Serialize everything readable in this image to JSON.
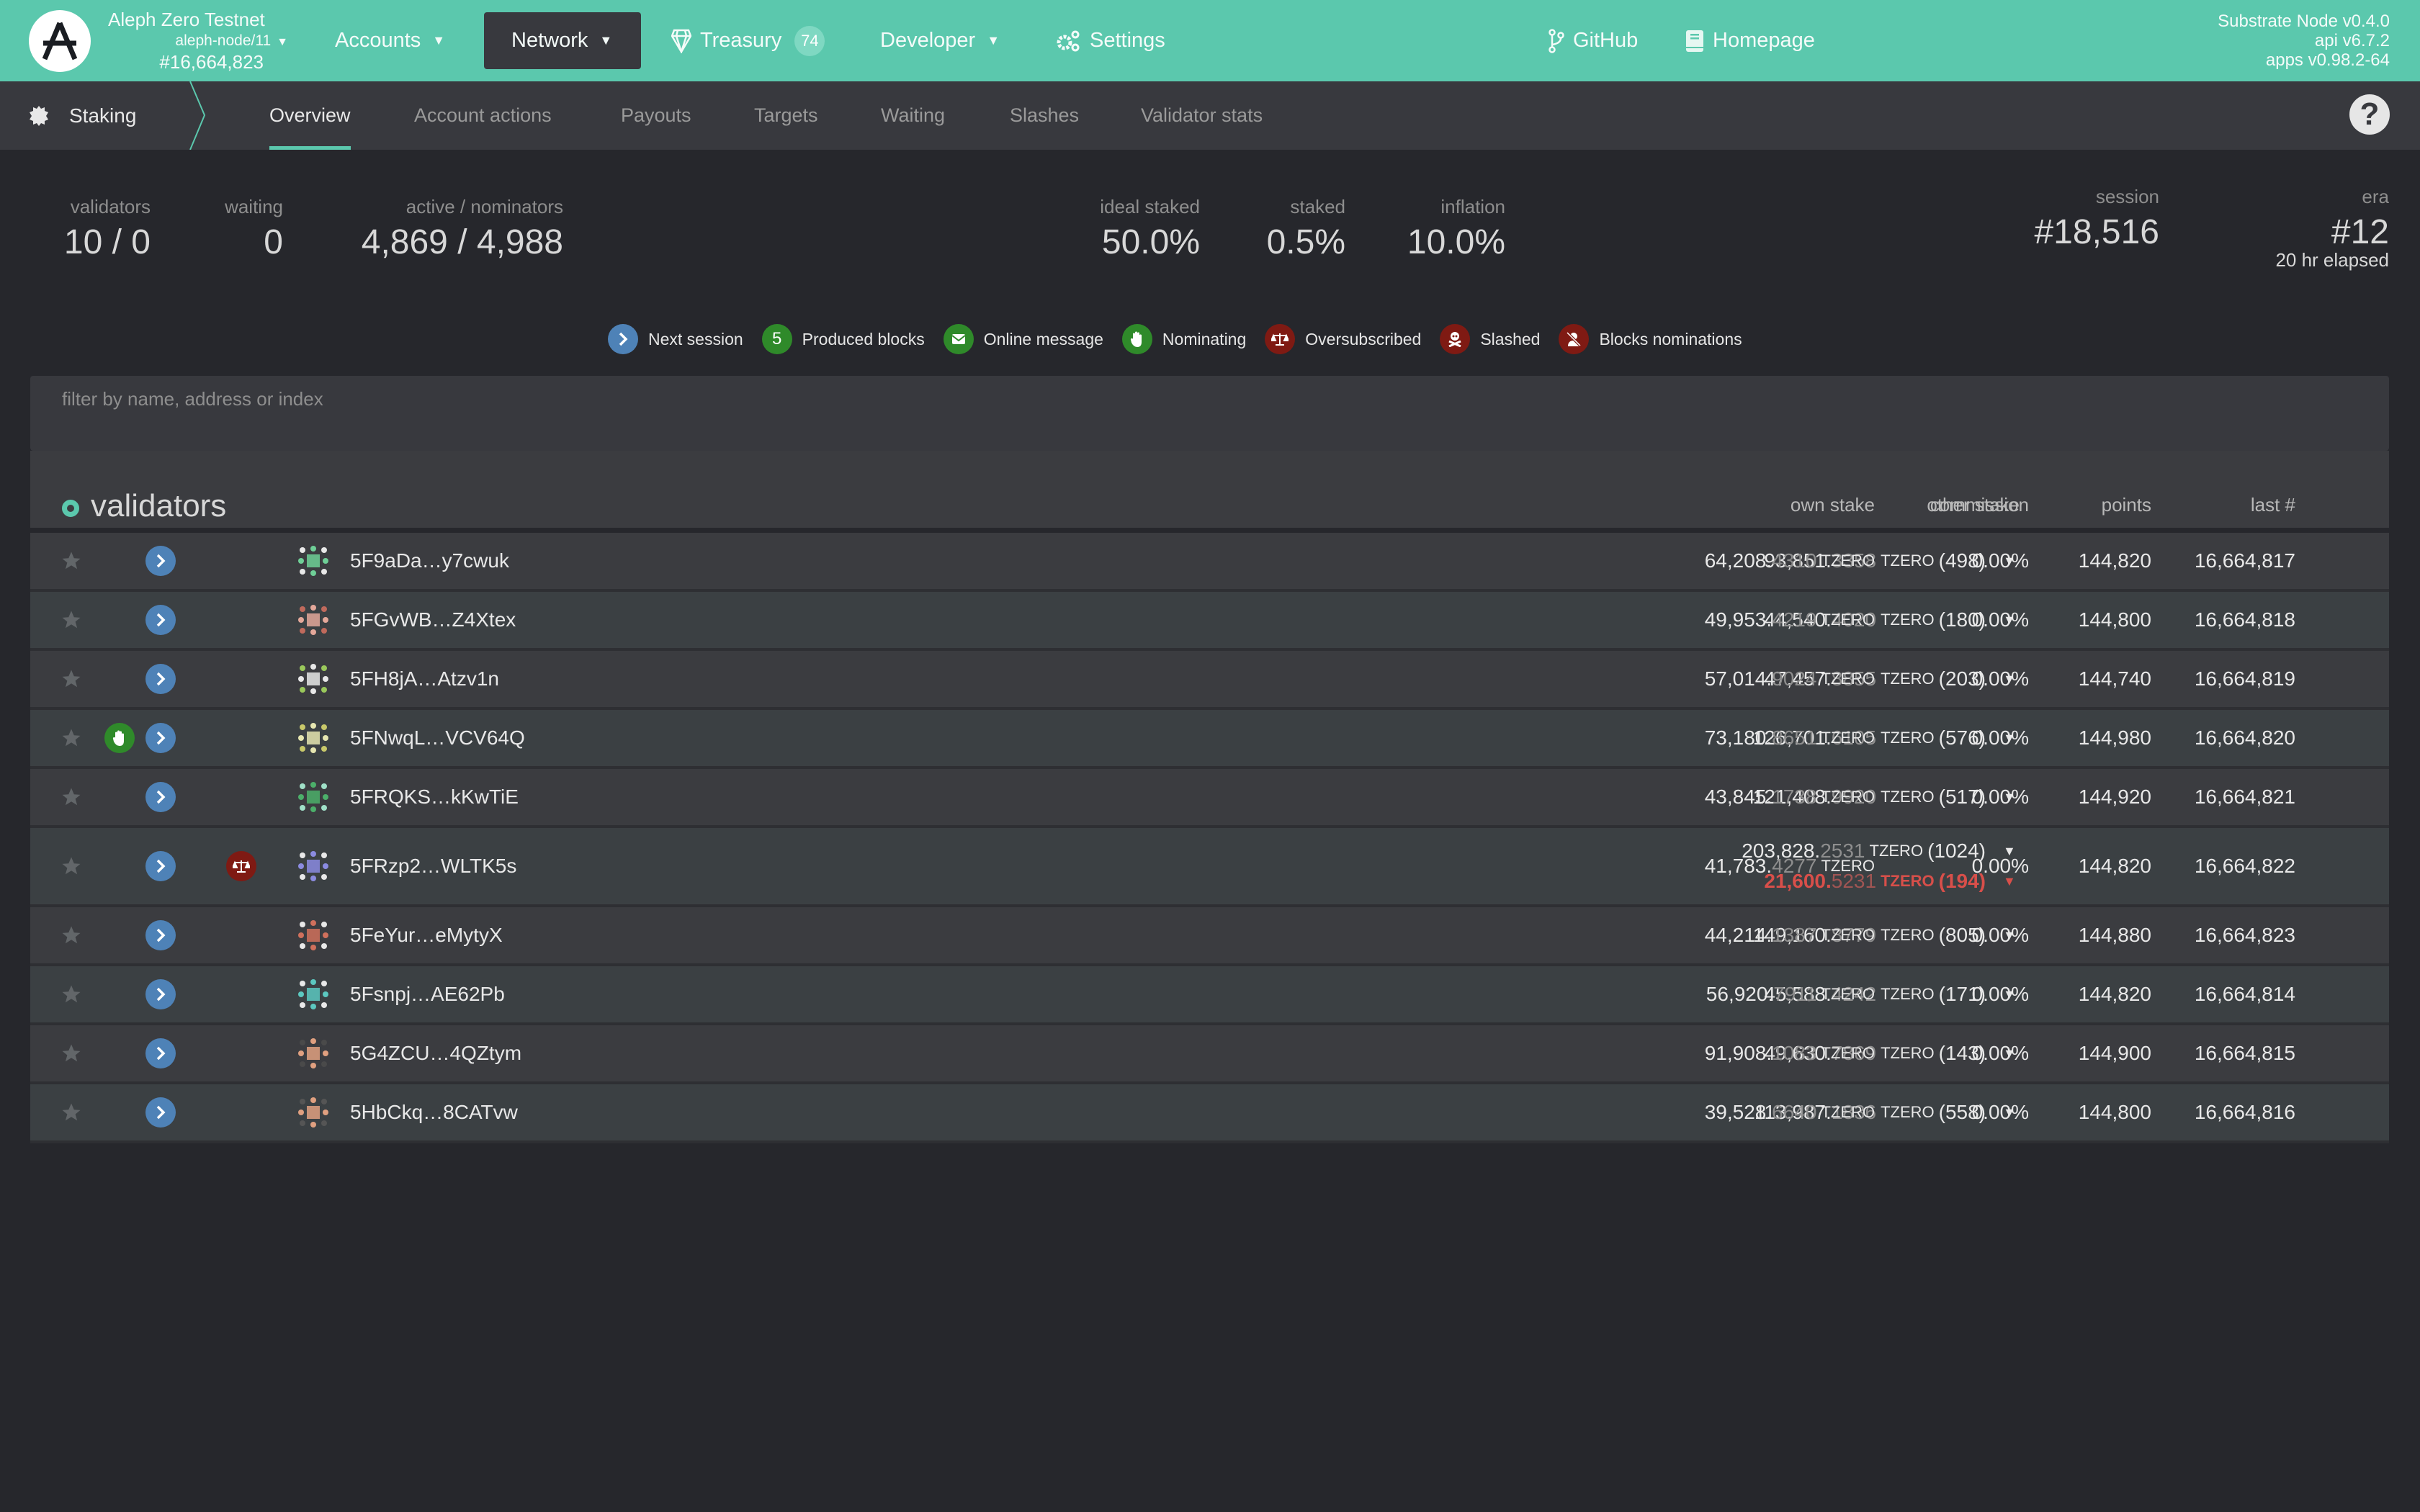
{
  "header": {
    "chain_name": "Aleph Zero Testnet",
    "node_name": "aleph-node/11",
    "best_block": "#16,664,823",
    "nav": [
      {
        "label": "Accounts",
        "dropdown": true
      },
      {
        "label": "Network",
        "dropdown": true,
        "active": true
      },
      {
        "label": "Treasury",
        "badge": "74",
        "icon": "gem-icon"
      },
      {
        "label": "Developer",
        "dropdown": true
      },
      {
        "label": "Settings",
        "icon": "gears-icon"
      }
    ],
    "links": [
      {
        "label": "GitHub",
        "icon": "code-branch-icon"
      },
      {
        "label": "Homepage",
        "icon": "book-icon"
      }
    ],
    "versions": [
      "Substrate Node v0.4.0",
      "api v6.7.2",
      "apps v0.98.2-64"
    ],
    "accent_color": "#5bc8ad"
  },
  "subnav": {
    "section": "Staking",
    "tabs": [
      "Overview",
      "Account actions",
      "Payouts",
      "Targets",
      "Waiting",
      "Slashes",
      "Validator stats"
    ],
    "active_tab": "Overview",
    "help": "?"
  },
  "summary": {
    "validators": {
      "label": "validators",
      "value": "10 / 0"
    },
    "waiting": {
      "label": "waiting",
      "value": "0"
    },
    "nominators": {
      "label": "active / nominators",
      "value": "4,869 / 4,988"
    },
    "ideal_staked": {
      "label": "ideal staked",
      "value": "50.0%"
    },
    "staked": {
      "label": "staked",
      "value": "0.5%"
    },
    "inflation": {
      "label": "inflation",
      "value": "10.0%"
    },
    "session": {
      "label": "session",
      "value": "#18,516"
    },
    "era": {
      "label": "era",
      "value": "#12",
      "sub": "20 hr elapsed"
    }
  },
  "legend": [
    {
      "label": "Next session",
      "icon": "chevron-right-icon",
      "color": "#4e82b7"
    },
    {
      "label": "Produced blocks",
      "icon": "5",
      "color": "#2f8a2a"
    },
    {
      "label": "Online message",
      "icon": "envelope-icon",
      "color": "#2f8a2a"
    },
    {
      "label": "Nominating",
      "icon": "hand-icon",
      "color": "#2f8a2a"
    },
    {
      "label": "Oversubscribed",
      "icon": "balance-scale-icon",
      "color": "#7f1a13"
    },
    {
      "label": "Slashed",
      "icon": "skull-crossbones-icon",
      "color": "#7f1a13"
    },
    {
      "label": "Blocks nominations",
      "icon": "user-slash-icon",
      "color": "#7f1a13"
    }
  ],
  "filter": {
    "placeholder": "filter by name, address or index",
    "value": ""
  },
  "table": {
    "title": "validators",
    "columns": {
      "other_stake": "other stake",
      "own_stake": "own stake",
      "commission": "commission",
      "points": "points",
      "last": "last #"
    },
    "unit": "TZERO",
    "rows": [
      {
        "address": "5F9aDa…y7cwuk",
        "nominating": false,
        "oversubscribed": false,
        "other": [
          {
            "int": "93,851.",
            "dec": "3358",
            "count": "(498)"
          }
        ],
        "own_int": "64,208.",
        "own_dec": "4310",
        "commission": "0.00%",
        "points": "144,820",
        "last": "16,664,817"
      },
      {
        "address": "5FGvWB…Z4Xtex",
        "nominating": false,
        "oversubscribed": false,
        "other": [
          {
            "int": "44,540.",
            "dec": "4020",
            "count": "(180)"
          }
        ],
        "own_int": "49,953.",
        "own_dec": "4219",
        "commission": "0.00%",
        "points": "144,800",
        "last": "16,664,818"
      },
      {
        "address": "5FH8jA…Atzv1n",
        "nominating": false,
        "oversubscribed": false,
        "other": [
          {
            "int": "47,457.",
            "dec": "8855",
            "count": "(203)"
          }
        ],
        "own_int": "57,014.",
        "own_dec": "9024",
        "commission": "0.00%",
        "points": "144,740",
        "last": "16,664,819"
      },
      {
        "address": "5FNwqL…VCV64Q",
        "nominating": true,
        "oversubscribed": false,
        "other": [
          {
            "int": "126,701.",
            "dec": "6105",
            "count": "(576)"
          }
        ],
        "own_int": "73,180.",
        "own_dec": "8651",
        "commission": "0.00%",
        "points": "144,980",
        "last": "16,664,820"
      },
      {
        "address": "5FRQKS…kKwTiE",
        "nominating": false,
        "oversubscribed": false,
        "other": [
          {
            "int": "121,408.",
            "dec": "9920",
            "count": "(517)"
          }
        ],
        "own_int": "43,845.",
        "own_dec": "1738",
        "commission": "0.00%",
        "points": "144,920",
        "last": "16,664,821"
      },
      {
        "address": "5FRzp2…WLTK5s",
        "nominating": false,
        "oversubscribed": true,
        "other": [
          {
            "int": "203,828.",
            "dec": "2531",
            "count": "(1024)"
          },
          {
            "int": "21,600.",
            "dec": "5231",
            "count": "(194)",
            "over": true
          }
        ],
        "own_int": "41,783.",
        "own_dec": "4277",
        "commission": "0.00%",
        "points": "144,820",
        "last": "16,664,822"
      },
      {
        "address": "5FeYur…eMytyX",
        "nominating": false,
        "oversubscribed": false,
        "other": [
          {
            "int": "149,160.",
            "dec": "8779",
            "count": "(805)"
          }
        ],
        "own_int": "44,214.",
        "own_dec": "1387",
        "commission": "0.00%",
        "points": "144,880",
        "last": "16,664,823"
      },
      {
        "address": "5Fsnpj…AE62Pb",
        "nominating": false,
        "oversubscribed": false,
        "other": [
          {
            "int": "45,588.",
            "dec": "4242",
            "count": "(171)"
          }
        ],
        "own_int": "56,920.",
        "own_dec": "7911",
        "commission": "0.00%",
        "points": "144,820",
        "last": "16,664,814"
      },
      {
        "address": "5G4ZCU…4QZtym",
        "nominating": false,
        "oversubscribed": false,
        "other": [
          {
            "int": "49,630.",
            "dec": "7869",
            "count": "(143)"
          }
        ],
        "own_int": "91,908.",
        "own_dec": "1083",
        "commission": "0.00%",
        "points": "144,900",
        "last": "16,664,815"
      },
      {
        "address": "5HbCkq…8CATvw",
        "nominating": false,
        "oversubscribed": false,
        "other": [
          {
            "int": "113,987.",
            "dec": "1836",
            "count": "(558)"
          }
        ],
        "own_int": "39,528.",
        "own_dec": "6640",
        "commission": "0.00%",
        "points": "144,800",
        "last": "16,664,816"
      }
    ]
  }
}
